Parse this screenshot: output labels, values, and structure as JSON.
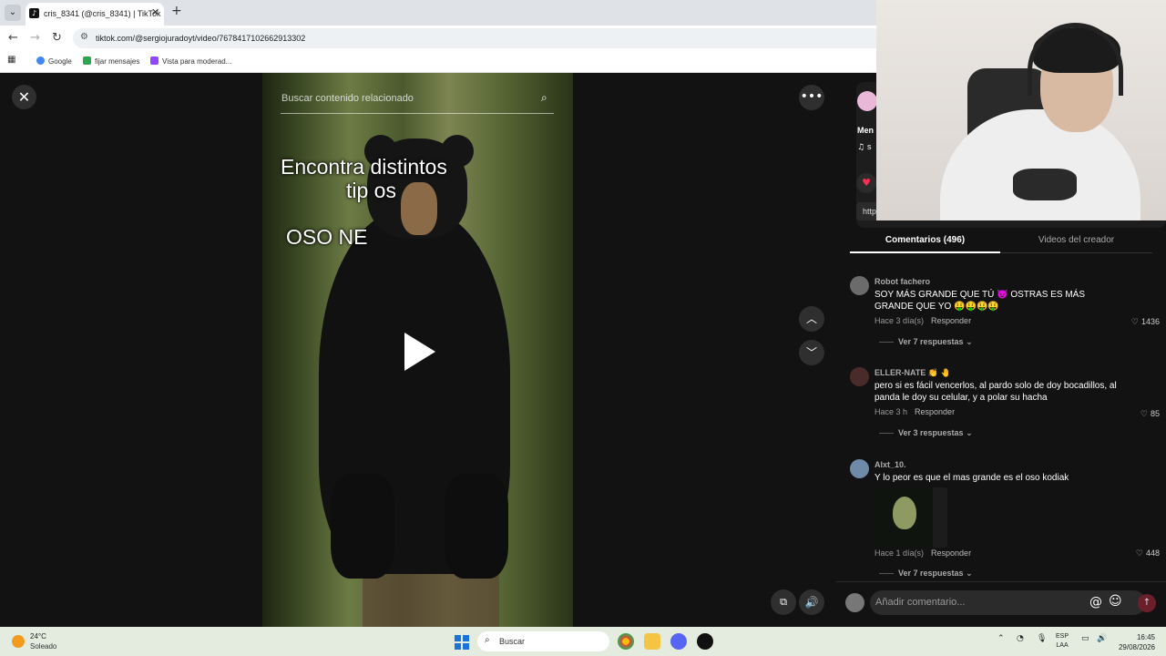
{
  "browser": {
    "tab_title": "cris_8341 (@cris_8341) | TikTok",
    "url": "tiktok.com/@sergiojuradoyt/video/7678417102662913302",
    "bookmarks": [
      "Google",
      "fijar mensajes",
      "Vista para moderad..."
    ]
  },
  "video": {
    "search_placeholder": "Buscar contenido relacionado",
    "overlay_line1": "Encontra distintos",
    "overlay_line2": "tip os",
    "overlay_line3": "OSO NE"
  },
  "panel": {
    "creator_fragment": "Men",
    "music_fragment": "s",
    "link_fragment": "http",
    "tabs": {
      "comments": "Comentarios (496)",
      "creator_videos": "Videos del creador"
    }
  },
  "comments": [
    {
      "user": "Robot fachero",
      "text": "SOY MÁS GRANDE QUE TÚ 👿 OSTRAS ES MÁS GRANDE QUE YO 🤑🤑🤑🤑",
      "time": "Hace 3 día(s)",
      "reply": "Responder",
      "likes": "1436",
      "more": "Ver 7 respuestas"
    },
    {
      "user": "ELLER-NATE 👏 🤚",
      "text": "pero si es fácil vencerlos, al pardo solo de doy bocadillos, al panda le doy su celular, y a polar su hacha",
      "time": "Hace 3 h",
      "reply": "Responder",
      "likes": "85",
      "more": "Ver 3 respuestas"
    },
    {
      "user": "Alxt_10.",
      "text": "Y lo peor es que el mas grande es el oso kodiak",
      "time": "Hace 1 día(s)",
      "reply": "Responder",
      "likes": "448",
      "more": "Ver 7 respuestas"
    }
  ],
  "compose": {
    "placeholder": "Añadir comentario..."
  },
  "taskbar": {
    "temp": "24°C",
    "weather": "Soleado",
    "search": "Buscar",
    "lang1": "ESP",
    "lang2": "LAA",
    "time": "16:45",
    "date": "29/08/2026"
  },
  "icons": {
    "close": "close-icon",
    "more": "more-icon",
    "play": "play-icon",
    "up": "chevron-up-icon",
    "down": "chevron-down-icon",
    "volume": "volume-icon"
  },
  "colors": {
    "accent": "#fe2c55",
    "panel_bg": "#121212"
  }
}
